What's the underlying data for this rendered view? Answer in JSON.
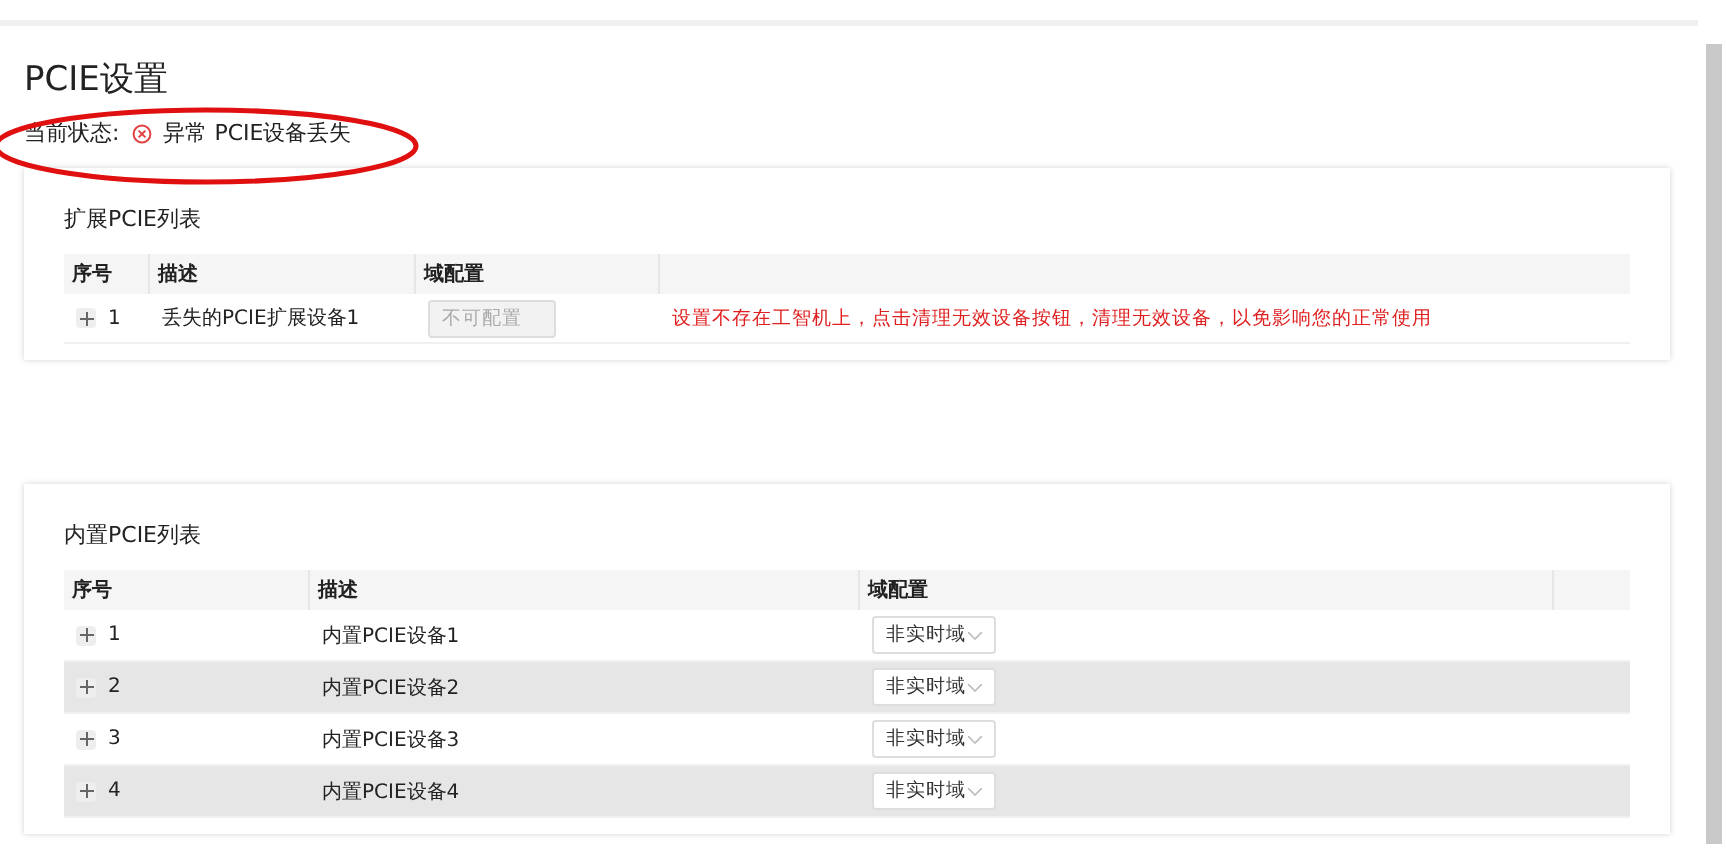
{
  "title": "PCIE设置",
  "status": {
    "label": "当前状态:",
    "text": "异常 PCIE设备丢失"
  },
  "external": {
    "title": "扩展PCIE列表",
    "columns": [
      "序号",
      "描述",
      "域配置"
    ],
    "rows": [
      {
        "index": "1",
        "description": "丢失的PCIE扩展设备1",
        "config": "不可配置",
        "disabled": true,
        "message": "设置不存在工智机上，点击清理无效设备按钮，清理无效设备，以免影响您的正常使用"
      }
    ]
  },
  "internal": {
    "title": "内置PCIE列表",
    "columns": [
      "序号",
      "描述",
      "域配置"
    ],
    "rows": [
      {
        "index": "1",
        "description": "内置PCIE设备1",
        "config": "非实时域"
      },
      {
        "index": "2",
        "description": "内置PCIE设备2",
        "config": "非实时域"
      },
      {
        "index": "3",
        "description": "内置PCIE设备3",
        "config": "非实时域"
      },
      {
        "index": "4",
        "description": "内置PCIE设备4",
        "config": "非实时域"
      }
    ]
  }
}
